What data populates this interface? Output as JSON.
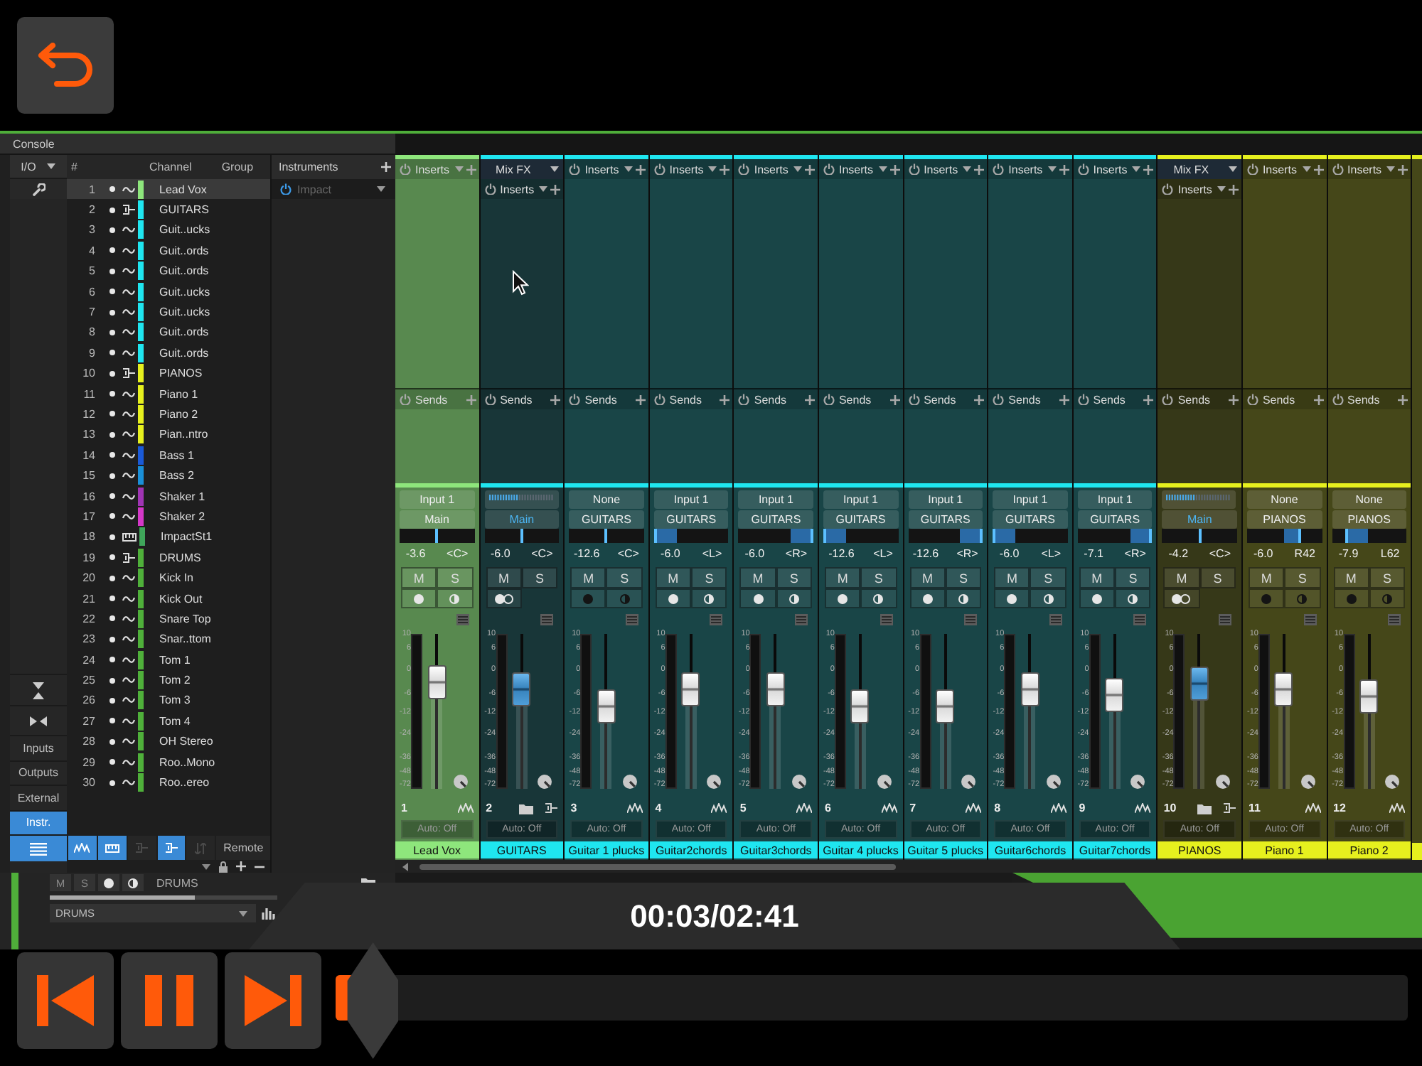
{
  "console": {
    "title": "Console",
    "io_label": "I/O",
    "side_buttons": [
      {
        "kind": "collapse",
        "selected": false
      },
      {
        "kind": "expand",
        "selected": false
      },
      {
        "kind": "text",
        "label": "Inputs",
        "selected": false
      },
      {
        "kind": "text",
        "label": "Outputs",
        "selected": false
      },
      {
        "kind": "text",
        "label": "External",
        "selected": false
      },
      {
        "kind": "text",
        "label": "Instr.",
        "selected": true
      },
      {
        "kind": "list",
        "selected": true
      }
    ],
    "columns": [
      "#",
      "Channel",
      "Group"
    ],
    "channels": [
      {
        "number": "1",
        "name": "Lead Vox",
        "kind": "audio",
        "color": "#8ee67c",
        "selected": true
      },
      {
        "number": "2",
        "name": "GUITARS",
        "kind": "bus",
        "color": "#1fe6f0",
        "selected": false
      },
      {
        "number": "3",
        "name": "Guit..ucks",
        "kind": "audio",
        "color": "#1fe6f0",
        "selected": false
      },
      {
        "number": "4",
        "name": "Guit..ords",
        "kind": "audio",
        "color": "#1fe6f0",
        "selected": false
      },
      {
        "number": "5",
        "name": "Guit..ords",
        "kind": "audio",
        "color": "#1fe6f0",
        "selected": false
      },
      {
        "number": "6",
        "name": "Guit..ucks",
        "kind": "audio",
        "color": "#1fe6f0",
        "selected": false
      },
      {
        "number": "7",
        "name": "Guit..ucks",
        "kind": "audio",
        "color": "#1fe6f0",
        "selected": false
      },
      {
        "number": "8",
        "name": "Guit..ords",
        "kind": "audio",
        "color": "#1fe6f0",
        "selected": false
      },
      {
        "number": "9",
        "name": "Guit..ords",
        "kind": "audio",
        "color": "#1fe6f0",
        "selected": false
      },
      {
        "number": "10",
        "name": "PIANOS",
        "kind": "bus",
        "color": "#e6f01e",
        "selected": false
      },
      {
        "number": "11",
        "name": "Piano 1",
        "kind": "audio",
        "color": "#e6f01e",
        "selected": false
      },
      {
        "number": "12",
        "name": "Piano 2",
        "kind": "audio",
        "color": "#e6f01e",
        "selected": false
      },
      {
        "number": "13",
        "name": "Pian..ntro",
        "kind": "audio",
        "color": "#e6f01e",
        "selected": false
      },
      {
        "number": "14",
        "name": "Bass 1",
        "kind": "audio",
        "color": "#1a5ad8",
        "selected": false
      },
      {
        "number": "15",
        "name": "Bass 2",
        "kind": "audio",
        "color": "#1a8fd8",
        "selected": false
      },
      {
        "number": "16",
        "name": "Shaker 1",
        "kind": "audio",
        "color": "#a034b4",
        "selected": false
      },
      {
        "number": "17",
        "name": "Shaker 2",
        "kind": "audio",
        "color": "#d438c8",
        "selected": false
      },
      {
        "number": "18",
        "name": "ImpactSt1",
        "kind": "instrument",
        "color": "#3fa65a",
        "selected": false
      },
      {
        "number": "19",
        "name": "DRUMS",
        "kind": "bus",
        "color": "#4fb03a",
        "selected": false
      },
      {
        "number": "20",
        "name": "Kick In",
        "kind": "audio",
        "color": "#4fb03a",
        "selected": false
      },
      {
        "number": "21",
        "name": "Kick Out",
        "kind": "audio",
        "color": "#4fb03a",
        "selected": false
      },
      {
        "number": "22",
        "name": "Snare Top",
        "kind": "audio",
        "color": "#4fb03a",
        "selected": false
      },
      {
        "number": "23",
        "name": "Snar..ttom",
        "kind": "audio",
        "color": "#4fb03a",
        "selected": false
      },
      {
        "number": "24",
        "name": "Tom 1",
        "kind": "audio",
        "color": "#4fb03a",
        "selected": false
      },
      {
        "number": "25",
        "name": "Tom 2",
        "kind": "audio",
        "color": "#4fb03a",
        "selected": false
      },
      {
        "number": "26",
        "name": "Tom 3",
        "kind": "audio",
        "color": "#4fb03a",
        "selected": false
      },
      {
        "number": "27",
        "name": "Tom 4",
        "kind": "audio",
        "color": "#4fb03a",
        "selected": false
      },
      {
        "number": "28",
        "name": "OH Stereo",
        "kind": "audio",
        "color": "#4fb03a",
        "selected": false
      },
      {
        "number": "29",
        "name": "Roo..Mono",
        "kind": "audio",
        "color": "#4fb03a",
        "selected": false
      },
      {
        "number": "30",
        "name": "Roo..ereo",
        "kind": "audio",
        "color": "#4fb03a",
        "selected": false
      }
    ],
    "toolbar": [
      {
        "kind": "meter",
        "selected": true
      },
      {
        "kind": "keyboard",
        "selected": true
      },
      {
        "kind": "bus",
        "selected": false
      },
      {
        "kind": "bus",
        "selected": true
      },
      {
        "kind": "arrows",
        "selected": false
      },
      {
        "kind": "text",
        "label": "Remote",
        "selected": false
      }
    ],
    "instruments": {
      "title": "Instruments",
      "items": [
        {
          "name": "Impact",
          "on": true
        }
      ]
    }
  },
  "mixer": {
    "strips": [
      {
        "kind": "audio",
        "selected": true,
        "color": "#8ee67c",
        "inserts": "Inserts",
        "sends": "Sends",
        "input": "Input 1",
        "output": "Main",
        "pan": {
          "reading": "<C>",
          "level": 0.5
        },
        "volume": {
          "reading": "-3.6",
          "level": 0.69
        },
        "mute": "M",
        "solo": "S",
        "arm_disabled": false,
        "scale": [
          "10",
          "6",
          "0",
          "-6",
          "-12",
          "-24",
          "-36",
          "-48",
          "-72"
        ],
        "number": "1",
        "automation": "Auto: Off",
        "name": "Lead Vox"
      },
      {
        "kind": "bus",
        "selected": false,
        "color": "#1fe6f0",
        "mix_fx": "Mix FX",
        "inserts": "Inserts",
        "sends": "Sends",
        "output": "Main",
        "pan": {
          "reading": "<C>",
          "level": 0.5
        },
        "volume": {
          "reading": "-6.0",
          "level": 0.64
        },
        "mute": "M",
        "solo": "S",
        "scale": [
          "10",
          "6",
          "0",
          "-6",
          "-12",
          "-24",
          "-36",
          "-48",
          "-72"
        ],
        "number": "2",
        "automation": "Auto: Off",
        "name": "GUITARS"
      },
      {
        "kind": "audio",
        "selected": false,
        "color": "#1fe6f0",
        "inserts": "Inserts",
        "sends": "Sends",
        "input": "None",
        "output": "GUITARS",
        "pan": {
          "reading": "<C>",
          "level": 0.5
        },
        "volume": {
          "reading": "-12.6",
          "level": 0.53
        },
        "mute": "M",
        "solo": "S",
        "arm_disabled": true,
        "scale": [
          "10",
          "6",
          "0",
          "-6",
          "-12",
          "-24",
          "-36",
          "-48",
          "-72"
        ],
        "number": "3",
        "automation": "Auto: Off",
        "name": "Guitar 1 plucks"
      },
      {
        "kind": "audio",
        "selected": false,
        "color": "#1fe6f0",
        "inserts": "Inserts",
        "sends": "Sends",
        "input": "Input 1",
        "output": "GUITARS",
        "pan": {
          "reading": "<L>",
          "level": 0
        },
        "volume": {
          "reading": "-6.0",
          "level": 0.64
        },
        "mute": "M",
        "solo": "S",
        "arm_disabled": false,
        "scale": [
          "10",
          "6",
          "0",
          "-6",
          "-12",
          "-24",
          "-36",
          "-48",
          "-72"
        ],
        "number": "4",
        "automation": "Auto: Off",
        "name": "Guitar2chords"
      },
      {
        "kind": "audio",
        "selected": false,
        "color": "#1fe6f0",
        "inserts": "Inserts",
        "sends": "Sends",
        "input": "Input 1",
        "output": "GUITARS",
        "pan": {
          "reading": "<R>",
          "level": 1
        },
        "volume": {
          "reading": "-6.0",
          "level": 0.64
        },
        "mute": "M",
        "solo": "S",
        "arm_disabled": false,
        "scale": [
          "10",
          "6",
          "0",
          "-6",
          "-12",
          "-24",
          "-36",
          "-48",
          "-72"
        ],
        "number": "5",
        "automation": "Auto: Off",
        "name": "Guitar3chords"
      },
      {
        "kind": "audio",
        "selected": false,
        "color": "#1fe6f0",
        "inserts": "Inserts",
        "sends": "Sends",
        "input": "Input 1",
        "output": "GUITARS",
        "pan": {
          "reading": "<L>",
          "level": 0
        },
        "volume": {
          "reading": "-12.6",
          "level": 0.53
        },
        "mute": "M",
        "solo": "S",
        "arm_disabled": false,
        "scale": [
          "10",
          "6",
          "0",
          "-6",
          "-12",
          "-24",
          "-36",
          "-48",
          "-72"
        ],
        "number": "6",
        "automation": "Auto: Off",
        "name": "Guitar 4 plucks"
      },
      {
        "kind": "audio",
        "selected": false,
        "color": "#1fe6f0",
        "inserts": "Inserts",
        "sends": "Sends",
        "input": "Input 1",
        "output": "GUITARS",
        "pan": {
          "reading": "<R>",
          "level": 1
        },
        "volume": {
          "reading": "-12.6",
          "level": 0.53
        },
        "mute": "M",
        "solo": "S",
        "arm_disabled": false,
        "scale": [
          "10",
          "6",
          "0",
          "-6",
          "-12",
          "-24",
          "-36",
          "-48",
          "-72"
        ],
        "number": "7",
        "automation": "Auto: Off",
        "name": "Guitar 5 plucks"
      },
      {
        "kind": "audio",
        "selected": false,
        "color": "#1fe6f0",
        "inserts": "Inserts",
        "sends": "Sends",
        "input": "Input 1",
        "output": "GUITARS",
        "pan": {
          "reading": "<L>",
          "level": 0
        },
        "volume": {
          "reading": "-6.0",
          "level": 0.64
        },
        "mute": "M",
        "solo": "S",
        "arm_disabled": false,
        "scale": [
          "10",
          "6",
          "0",
          "-6",
          "-12",
          "-24",
          "-36",
          "-48",
          "-72"
        ],
        "number": "8",
        "automation": "Auto: Off",
        "name": "Guitar6chords"
      },
      {
        "kind": "audio",
        "selected": false,
        "color": "#1fe6f0",
        "inserts": "Inserts",
        "sends": "Sends",
        "input": "Input 1",
        "output": "GUITARS",
        "pan": {
          "reading": "<R>",
          "level": 1
        },
        "volume": {
          "reading": "-7.1",
          "level": 0.61
        },
        "mute": "M",
        "solo": "S",
        "arm_disabled": false,
        "scale": [
          "10",
          "6",
          "0",
          "-6",
          "-12",
          "-24",
          "-36",
          "-48",
          "-72"
        ],
        "number": "9",
        "automation": "Auto: Off",
        "name": "Guitar7chords"
      },
      {
        "kind": "bus",
        "selected": false,
        "color": "#e6f01e",
        "mix_fx": "Mix FX",
        "inserts": "Inserts",
        "sends": "Sends",
        "output": "Main",
        "pan": {
          "reading": "<C>",
          "level": 0.5
        },
        "volume": {
          "reading": "-4.2",
          "level": 0.68
        },
        "mute": "M",
        "solo": "S",
        "scale": [
          "10",
          "6",
          "0",
          "-6",
          "-12",
          "-24",
          "-36",
          "-48",
          "-72"
        ],
        "number": "10",
        "automation": "Auto: Off",
        "name": "PIANOS"
      },
      {
        "kind": "audio",
        "selected": false,
        "color": "#e6f01e",
        "inserts": "Inserts",
        "sends": "Sends",
        "input": "None",
        "output": "PIANOS",
        "pan": {
          "reading": "R42",
          "level": 0.71
        },
        "volume": {
          "reading": "-6.0",
          "level": 0.64
        },
        "mute": "M",
        "solo": "S",
        "arm_disabled": true,
        "scale": [
          "10",
          "6",
          "0",
          "-6",
          "-12",
          "-24",
          "-36",
          "-48",
          "-72"
        ],
        "number": "11",
        "automation": "Auto: Off",
        "name": "Piano 1"
      },
      {
        "kind": "audio",
        "selected": false,
        "color": "#e6f01e",
        "inserts": "Inserts",
        "sends": "Sends",
        "input": "None",
        "output": "PIANOS",
        "pan": {
          "reading": "L62",
          "level": 0.19
        },
        "volume": {
          "reading": "-7.9",
          "level": 0.6
        },
        "mute": "M",
        "solo": "S",
        "arm_disabled": true,
        "scale": [
          "10",
          "6",
          "0",
          "-6",
          "-12",
          "-24",
          "-36",
          "-48",
          "-72"
        ],
        "number": "12",
        "automation": "Auto: Off",
        "name": "Piano 2"
      },
      {
        "kind": "cut",
        "color": "#e6f01e"
      }
    ]
  },
  "inspector": {
    "mute": "M",
    "solo": "S",
    "name": "DRUMS",
    "slider": {
      "level": 0.64
    },
    "preset": "DRUMS"
  },
  "player": {
    "time": "00:03/02:41",
    "progress": {
      "level": 0.019
    }
  }
}
